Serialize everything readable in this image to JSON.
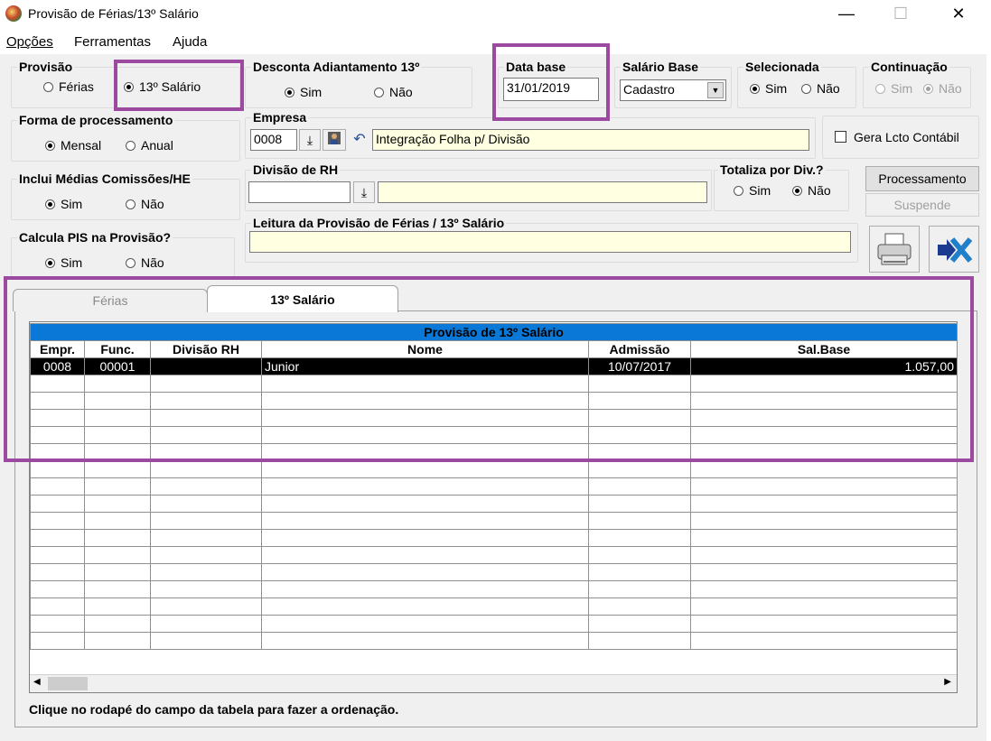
{
  "window": {
    "title": "Provisão de Férias/13º Salário",
    "minimize": "—",
    "maximize": "☐",
    "close": "✕"
  },
  "menu": {
    "opcoes": "Opções",
    "ferramentas": "Ferramentas",
    "ajuda": "Ajuda"
  },
  "provisao": {
    "label": "Provisão",
    "ferias": "Férias",
    "decimo": "13º Salário",
    "selected": "13º Salário"
  },
  "desconta": {
    "label": "Desconta Adiantamento 13º",
    "sim": "Sim",
    "nao": "Não",
    "selected": "Sim"
  },
  "data_base": {
    "label": "Data base",
    "value": "31/01/2019"
  },
  "salario_base": {
    "label": "Salário Base",
    "value": "Cadastro"
  },
  "selecionada": {
    "label": "Selecionada",
    "sim": "Sim",
    "nao": "Não",
    "selected": "Sim"
  },
  "continuacao": {
    "label": "Continuação",
    "sim": "Sim",
    "nao": "Não",
    "selected": "Não",
    "disabled": true
  },
  "forma": {
    "label": "Forma de processamento",
    "mensal": "Mensal",
    "anual": "Anual",
    "selected": "Mensal"
  },
  "empresa": {
    "label": "Empresa",
    "code": "0008",
    "name": "Integração Folha p/ Divisão"
  },
  "gera_lcto": {
    "label": "Gera Lcto Contábil",
    "checked": false
  },
  "inclui_medias": {
    "label": "Inclui Médias Comissões/HE",
    "sim": "Sim",
    "nao": "Não",
    "selected": "Sim"
  },
  "divisao": {
    "label": "Divisão de RH",
    "code": "",
    "name": ""
  },
  "totaliza": {
    "label": "Totaliza por Div.?",
    "sim": "Sim",
    "nao": "Não",
    "selected": "Não"
  },
  "buttons": {
    "processamento": "Processamento",
    "suspende": "Suspende"
  },
  "calcula_pis": {
    "label": "Calcula PIS na Provisão?",
    "sim": "Sim",
    "nao": "Não",
    "selected": "Sim"
  },
  "leitura": {
    "label": "Leitura da Provisão de Férias / 13º Salário",
    "value": ""
  },
  "tabs": [
    {
      "label": "Férias",
      "active": false
    },
    {
      "label": "13º Salário",
      "active": true
    }
  ],
  "grid": {
    "title": "Provisão de 13º Salário",
    "columns": [
      "Empr.",
      "Func.",
      "Divisão RH",
      "Nome",
      "Admissão",
      "Sal.Base"
    ],
    "rows": [
      [
        "0008",
        "00001",
        "",
        "Junior",
        "10/07/2017",
        "1.057,00"
      ]
    ]
  },
  "footer": "Clique no rodapé do campo da tabela  para fazer a ordenação.",
  "icons": {
    "print": "printer-icon",
    "exit": "exit-icon",
    "accent": "#9b4a9f",
    "grid_header": "#0a78d7"
  }
}
